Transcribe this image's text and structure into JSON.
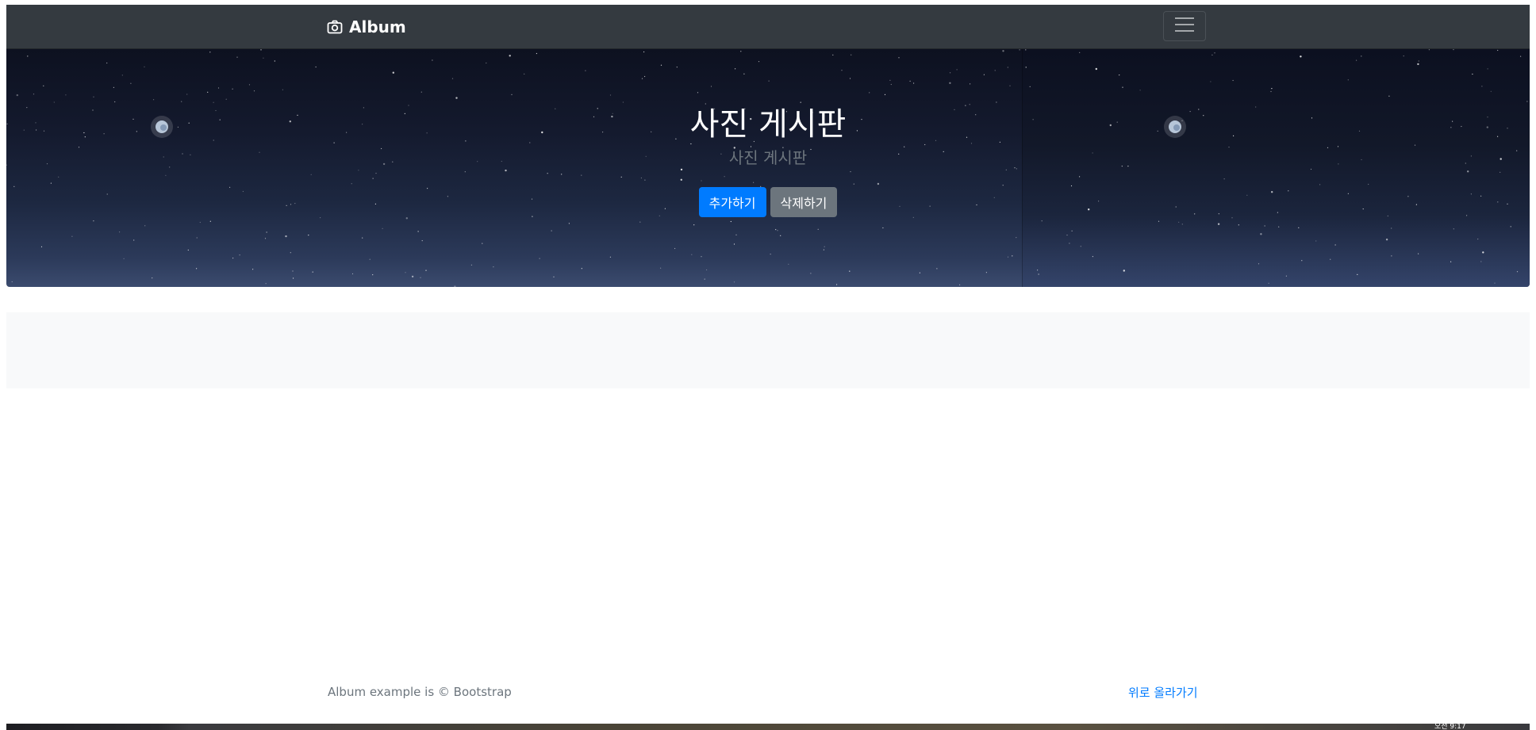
{
  "navbar": {
    "brand_label": "Album",
    "brand_icon": "camera-icon",
    "toggler_icon": "hamburger-menu-icon"
  },
  "hero": {
    "title": "사진 게시판",
    "lead": "사진 게시판",
    "add_button_label": "추가하기",
    "delete_button_label": "삭제하기"
  },
  "footer": {
    "text": "Album example is © Bootstrap",
    "back_to_top_label": "위로 올라가기"
  },
  "taskbar": {
    "clock_text": "오전 9:17"
  },
  "colors": {
    "navbar_bg": "#343a40",
    "primary": "#007bff",
    "secondary": "#6c757d",
    "album_bg": "#f8f9fa"
  }
}
